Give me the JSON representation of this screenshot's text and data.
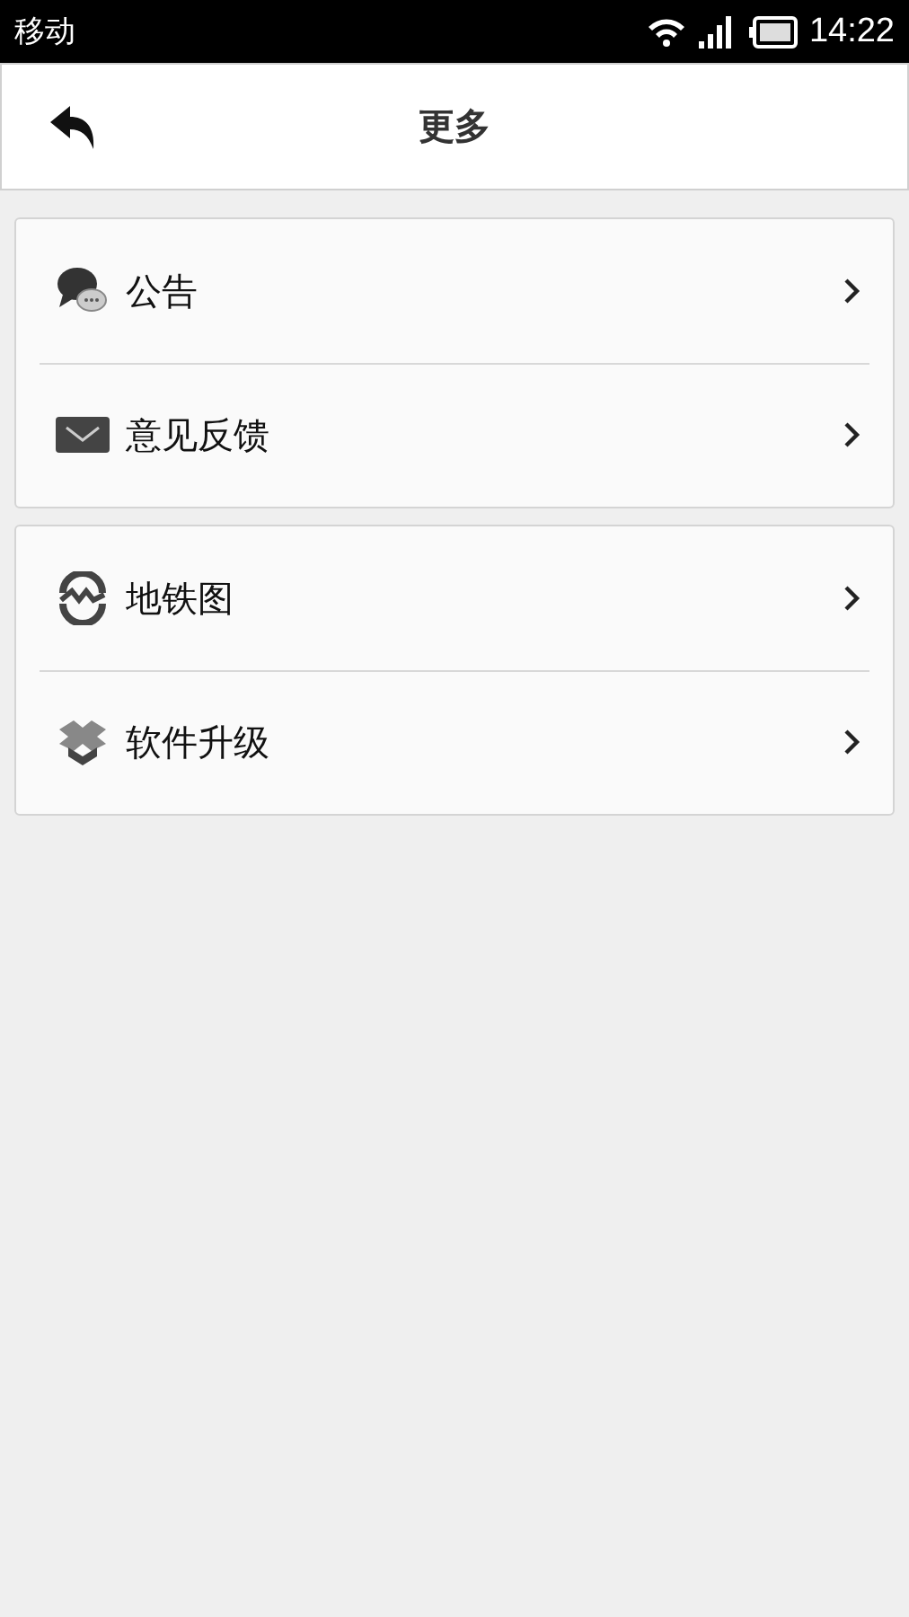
{
  "status_bar": {
    "carrier": "移动",
    "time": "14:22"
  },
  "header": {
    "title": "更多"
  },
  "groups": [
    {
      "items": [
        {
          "kind": "speech",
          "label": "公告"
        },
        {
          "kind": "mail",
          "label": "意见反馈"
        }
      ]
    },
    {
      "items": [
        {
          "kind": "metro",
          "label": "地铁图"
        },
        {
          "kind": "box",
          "label": "软件升级"
        }
      ]
    }
  ]
}
